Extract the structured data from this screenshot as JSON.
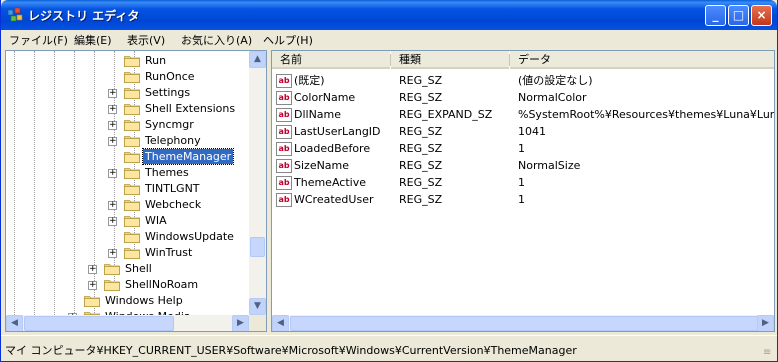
{
  "window": {
    "title": "レジストリ エディタ",
    "controls": {
      "minimize": "_",
      "maximize": "□",
      "close": "×"
    }
  },
  "menu": [
    "ファイル(F)",
    "編集(E)",
    "表示(V)",
    "お気に入り(A)",
    "ヘルプ(H)"
  ],
  "tree": {
    "items": [
      {
        "label": "Run",
        "expandable": false
      },
      {
        "label": "RunOnce",
        "expandable": false
      },
      {
        "label": "Settings",
        "expandable": true
      },
      {
        "label": "Shell Extensions",
        "expandable": true
      },
      {
        "label": "Syncmgr",
        "expandable": true
      },
      {
        "label": "Telephony",
        "expandable": true
      },
      {
        "label": "ThemeManager",
        "expandable": false,
        "selected": true
      },
      {
        "label": "Themes",
        "expandable": true
      },
      {
        "label": "TINTLGNT",
        "expandable": false
      },
      {
        "label": "Webcheck",
        "expandable": true
      },
      {
        "label": "WIA",
        "expandable": true
      },
      {
        "label": "WindowsUpdate",
        "expandable": false
      },
      {
        "label": "WinTrust",
        "expandable": true
      },
      {
        "label": "Shell",
        "expandable": true
      },
      {
        "label": "ShellNoRoam",
        "expandable": true
      },
      {
        "label": "Windows Help",
        "expandable": false
      },
      {
        "label": "Windows Media",
        "expandable": true
      }
    ]
  },
  "list": {
    "columns": [
      "名前",
      "種類",
      "データ"
    ],
    "rows": [
      {
        "name": "(既定)",
        "type": "REG_SZ",
        "data": "(値の設定なし)"
      },
      {
        "name": "ColorName",
        "type": "REG_SZ",
        "data": "NormalColor"
      },
      {
        "name": "DllName",
        "type": "REG_EXPAND_SZ",
        "data": "%SystemRoot%¥Resources¥themes¥Luna¥Luna.msstyles"
      },
      {
        "name": "LastUserLangID",
        "type": "REG_SZ",
        "data": "1041"
      },
      {
        "name": "LoadedBefore",
        "type": "REG_SZ",
        "data": "1"
      },
      {
        "name": "SizeName",
        "type": "REG_SZ",
        "data": "NormalSize"
      },
      {
        "name": "ThemeActive",
        "type": "REG_SZ",
        "data": "1"
      },
      {
        "name": "WCreatedUser",
        "type": "REG_SZ",
        "data": "1"
      }
    ],
    "value_icon": "ab"
  },
  "scrollbar_glyphs": {
    "up": "▲",
    "down": "▼",
    "left": "◀",
    "right": "▶",
    "grip": "≡"
  },
  "statusbar": {
    "path": "マイ コンピュータ¥HKEY_CURRENT_USER¥Software¥Microsoft¥Windows¥CurrentVersion¥ThemeManager"
  },
  "colors": {
    "titlebar": "#0054E3",
    "selection": "#316AC5",
    "folder": "#F5D77A"
  }
}
